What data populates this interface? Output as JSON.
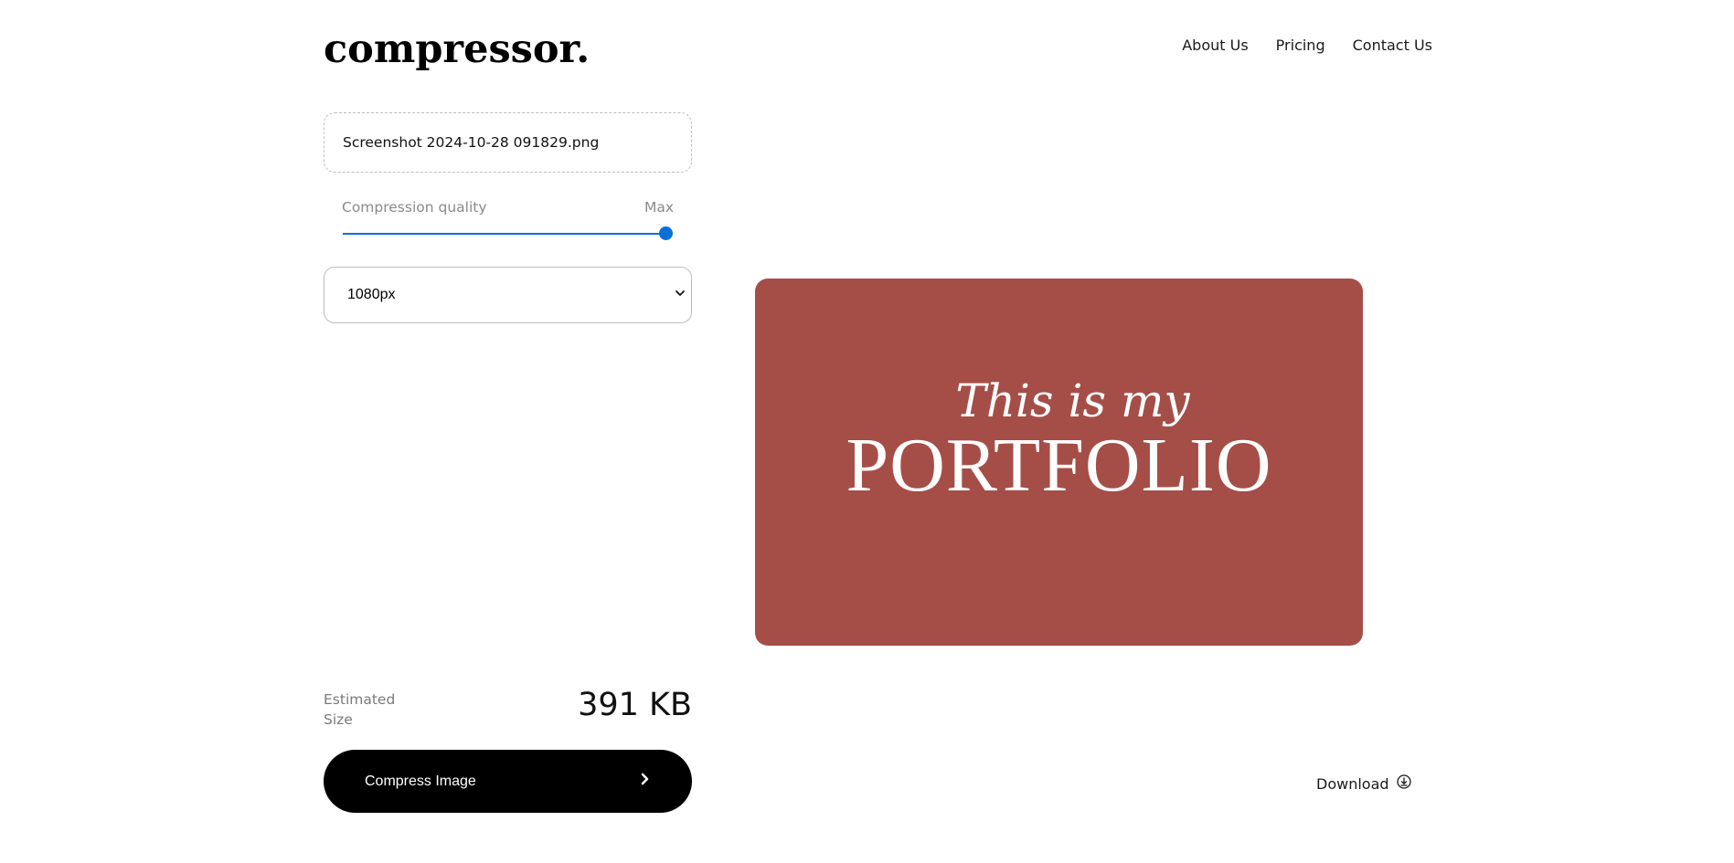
{
  "brand": {
    "logo": "compressor."
  },
  "nav": {
    "items": [
      "About Us",
      "Pricing",
      "Contact Us"
    ]
  },
  "upload": {
    "filename": "Screenshot 2024-10-28 091829.png"
  },
  "quality": {
    "label": "Compression quality",
    "value_label": "Max",
    "level_percent": 100
  },
  "resolution": {
    "selected": "1080px"
  },
  "preview": {
    "line1": "This is my",
    "line2": "PORTFOLIO",
    "background_color": "#a54e47"
  },
  "estimate": {
    "label": "Estimated Size",
    "value": "391 KB"
  },
  "actions": {
    "compress_label": "Compress Image",
    "download_label": "Download"
  },
  "colors": {
    "accent": "#0b6fd8",
    "button": "#000000"
  },
  "icons": {
    "compress": "chevron-right-icon",
    "download": "download-circle-icon",
    "select": "chevron-down-icon"
  }
}
